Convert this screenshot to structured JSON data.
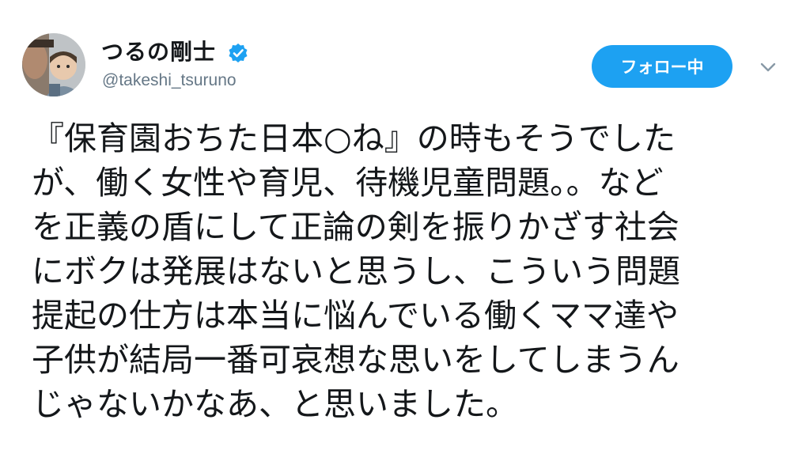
{
  "author": {
    "display_name": "つるの剛士",
    "handle": "@takeshi_tsuruno",
    "verified_icon": "verified-badge-icon",
    "avatar": "profile-photo"
  },
  "actions": {
    "follow_label": "フォロー中",
    "menu_icon": "chevron-down-icon"
  },
  "tweet": {
    "lines": [
      "『保育園おちた日本○ね』の時もそうでした",
      "が、働く女性や育児、待機児童問題。。など",
      "を正義の盾にして正論の剣を振りかざす社会",
      "にボクは発展はないと思うし、こういう問題",
      "提起の仕方は本当に悩んでいる働くママ達や",
      "子供が結局一番可哀想な思いをしてしまうん",
      "じゃないかなあ、と思いました。"
    ]
  },
  "colors": {
    "accent": "#1da1f2",
    "text": "#14171a",
    "secondary_text": "#657786"
  }
}
